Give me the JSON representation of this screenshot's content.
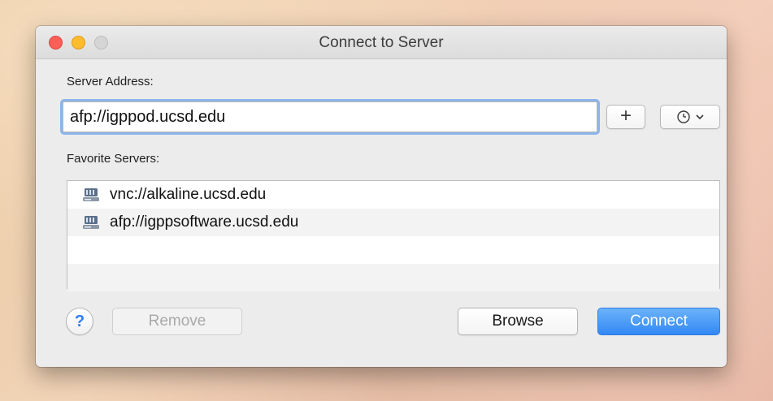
{
  "window": {
    "title": "Connect to Server"
  },
  "server_address": {
    "label": "Server Address:",
    "value": "afp://igppod.ucsd.edu"
  },
  "favorites": {
    "label": "Favorite Servers:",
    "items": [
      {
        "label": "vnc://alkaline.ucsd.edu"
      },
      {
        "label": "afp://igppsoftware.ucsd.edu"
      }
    ]
  },
  "buttons": {
    "help": "?",
    "remove": "Remove",
    "browse": "Browse",
    "connect": "Connect"
  },
  "icons": {
    "add": "plus-icon",
    "recent": "clock-icon",
    "dropdown": "chevron-down-icon",
    "server": "network-drive-icon"
  },
  "colors": {
    "accent": "#3288f4",
    "close": "#fc5f57",
    "minimize": "#fdbc2e",
    "zoom": "#d5d5d5"
  }
}
